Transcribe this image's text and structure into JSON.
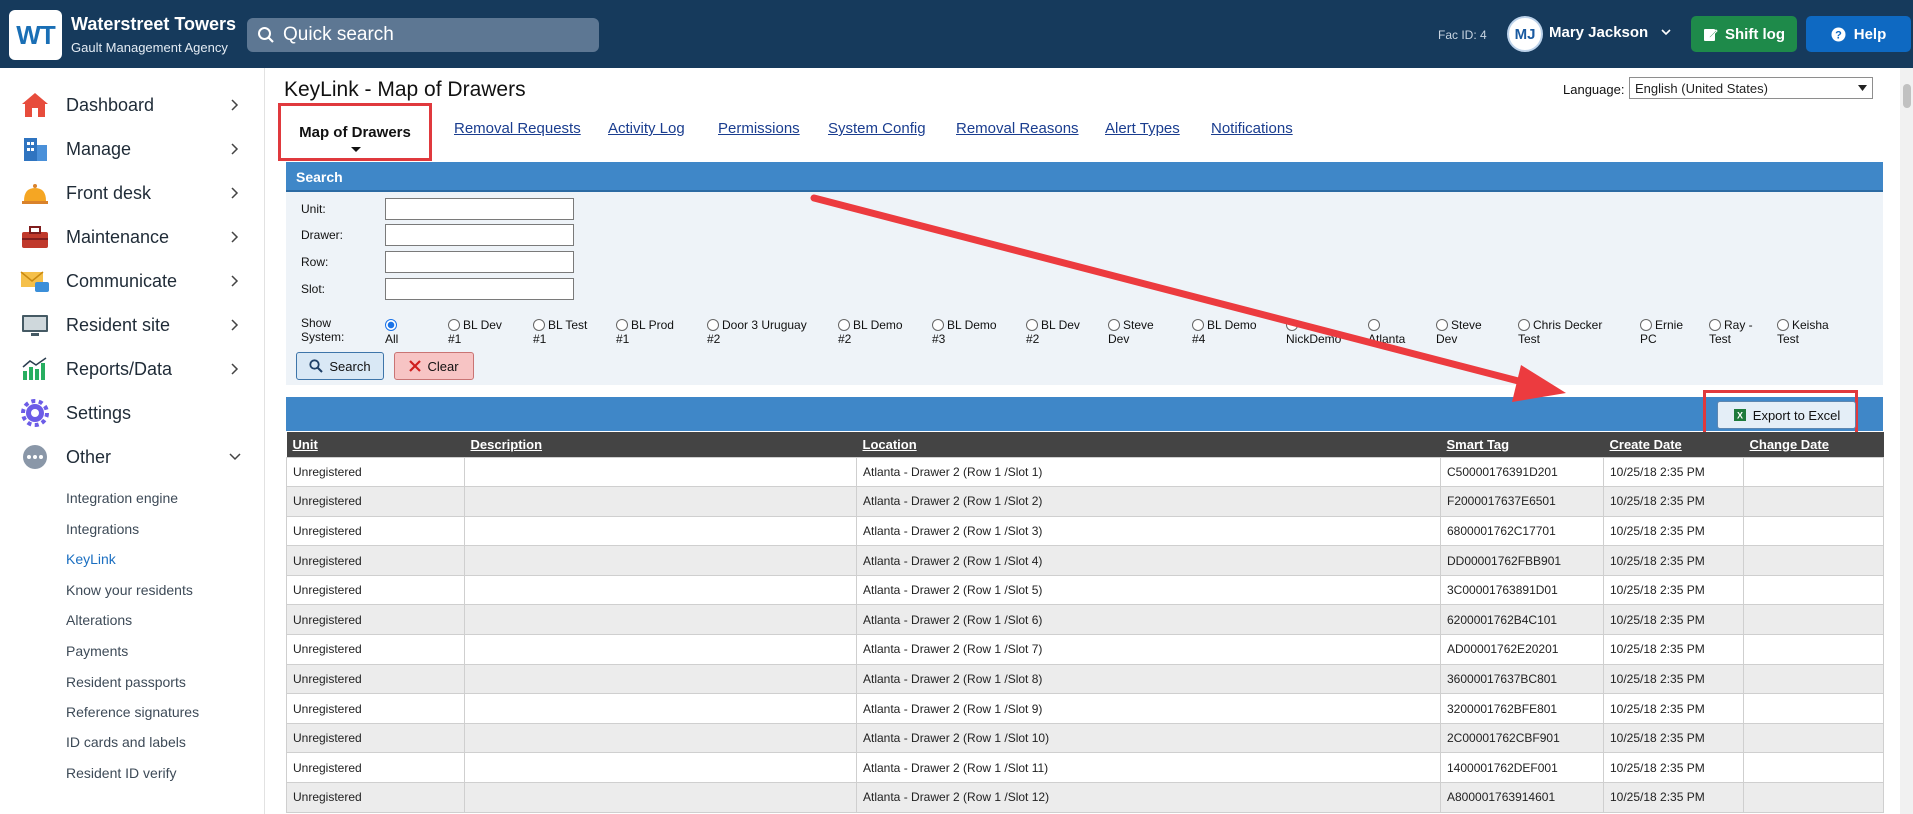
{
  "header": {
    "logo_text": "WT",
    "brand_name": "Waterstreet Towers",
    "brand_sub": "Gault Management Agency",
    "search_placeholder": "Quick search",
    "fac_id": "Fac ID: 4",
    "avatar_initials": "MJ",
    "user_name": "Mary Jackson",
    "shift_log_label": "Shift log",
    "help_label": "Help"
  },
  "sidebar": {
    "items": [
      {
        "label": "Dashboard",
        "icon": "house-icon"
      },
      {
        "label": "Manage",
        "icon": "building-icon"
      },
      {
        "label": "Front desk",
        "icon": "bell-icon"
      },
      {
        "label": "Maintenance",
        "icon": "toolbox-icon"
      },
      {
        "label": "Communicate",
        "icon": "mail-icon"
      },
      {
        "label": "Resident site",
        "icon": "monitor-icon"
      },
      {
        "label": "Reports/Data",
        "icon": "chart-icon"
      },
      {
        "label": "Settings",
        "icon": "gear-icon"
      },
      {
        "label": "Other",
        "icon": "more-icon"
      }
    ],
    "subitems": [
      "Integration engine",
      "Integrations",
      "KeyLink",
      "Know your residents",
      "Alterations",
      "Payments",
      "Resident passports",
      "Reference signatures",
      "ID cards and labels",
      "Resident ID verify"
    ]
  },
  "main": {
    "title": "KeyLink - Map of Drawers",
    "language_label": "Language:",
    "language_value": "English (United States)",
    "tabs": [
      "Map of Drawers",
      "Removal Requests",
      "Activity Log",
      "Permissions",
      "System Config",
      "Removal Reasons",
      "Alert Types",
      "Notifications"
    ]
  },
  "search": {
    "heading": "Search",
    "unit_label": "Unit:",
    "drawer_label": "Drawer:",
    "row_label": "Row:",
    "slot_label": "Slot:",
    "show_system_label": "Show\nSystem:",
    "systems": [
      {
        "l1": "",
        "l2": "All"
      },
      {
        "l1": "BL Dev",
        "l2": "#1"
      },
      {
        "l1": "BL Test",
        "l2": "#1"
      },
      {
        "l1": "BL Prod",
        "l2": "#1"
      },
      {
        "l1": "Door 3 Uruguay",
        "l2": "#2"
      },
      {
        "l1": "BL Demo",
        "l2": "#2"
      },
      {
        "l1": "BL Demo",
        "l2": "#3"
      },
      {
        "l1": "BL Dev",
        "l2": "#2"
      },
      {
        "l1": "Steve",
        "l2": "Dev"
      },
      {
        "l1": "BL Demo",
        "l2": "#4"
      },
      {
        "l1": "",
        "l2": "NickDemo"
      },
      {
        "l1": "",
        "l2": "Atlanta"
      },
      {
        "l1": "Steve",
        "l2": "Dev"
      },
      {
        "l1": "Chris Decker",
        "l2": "Test"
      },
      {
        "l1": "Ernie",
        "l2": "PC"
      },
      {
        "l1": "Ray -",
        "l2": "Test"
      },
      {
        "l1": "Keisha",
        "l2": "Test"
      }
    ],
    "search_button": "Search",
    "clear_button": "Clear"
  },
  "grid": {
    "export_label": "Export to Excel",
    "columns": [
      "Unit",
      "Description",
      "Location",
      "Smart Tag",
      "Create Date",
      "Change Date"
    ],
    "rows": [
      [
        "Unregistered",
        "",
        "Atlanta - Drawer 2 (Row 1 /Slot 1)",
        "C50000176391D201",
        "10/25/18 2:35 PM",
        ""
      ],
      [
        "Unregistered",
        "",
        "Atlanta - Drawer 2 (Row 1 /Slot 2)",
        "F2000017637E6501",
        "10/25/18 2:35 PM",
        ""
      ],
      [
        "Unregistered",
        "",
        "Atlanta - Drawer 2 (Row 1 /Slot 3)",
        "6800001762C17701",
        "10/25/18 2:35 PM",
        ""
      ],
      [
        "Unregistered",
        "",
        "Atlanta - Drawer 2 (Row 1 /Slot 4)",
        "DD00001762FBB901",
        "10/25/18 2:35 PM",
        ""
      ],
      [
        "Unregistered",
        "",
        "Atlanta - Drawer 2 (Row 1 /Slot 5)",
        "3C00001763891D01",
        "10/25/18 2:35 PM",
        ""
      ],
      [
        "Unregistered",
        "",
        "Atlanta - Drawer 2 (Row 1 /Slot 6)",
        "6200001762B4C101",
        "10/25/18 2:35 PM",
        ""
      ],
      [
        "Unregistered",
        "",
        "Atlanta - Drawer 2 (Row 1 /Slot 7)",
        "AD00001762E20201",
        "10/25/18 2:35 PM",
        ""
      ],
      [
        "Unregistered",
        "",
        "Atlanta - Drawer 2 (Row 1 /Slot 8)",
        "36000017637BC801",
        "10/25/18 2:35 PM",
        ""
      ],
      [
        "Unregistered",
        "",
        "Atlanta - Drawer 2 (Row 1 /Slot 9)",
        "3200001762BFE801",
        "10/25/18 2:35 PM",
        ""
      ],
      [
        "Unregistered",
        "",
        "Atlanta - Drawer 2 (Row 1 /Slot 10)",
        "2C00001762CBF901",
        "10/25/18 2:35 PM",
        ""
      ],
      [
        "Unregistered",
        "",
        "Atlanta - Drawer 2 (Row 1 /Slot 11)",
        "1400001762DEF001",
        "10/25/18 2:35 PM",
        ""
      ],
      [
        "Unregistered",
        "",
        "Atlanta - Drawer 2 (Row 1 /Slot 12)",
        "A800001763914601",
        "10/25/18 2:35 PM",
        ""
      ]
    ]
  },
  "colors": {
    "topbar": "#163a5c",
    "panel_head": "#3f87c8",
    "highlight": "#e0393d",
    "shift_green": "#1e8a4a",
    "help_blue": "#0e69c2"
  }
}
